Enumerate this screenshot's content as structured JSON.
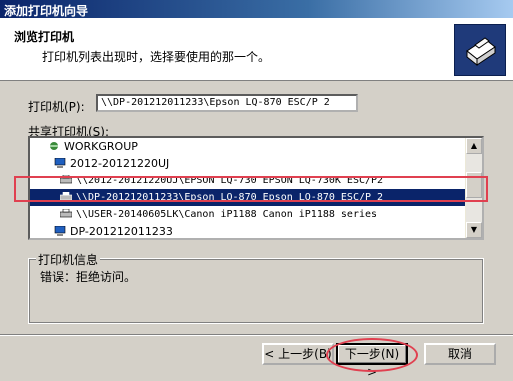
{
  "window": {
    "title": "添加打印机向导"
  },
  "header": {
    "title": "浏览打印机",
    "subtitle": "打印机列表出现时，选择要使用的那一个。",
    "logo_icon": "printer-wizard-icon"
  },
  "form": {
    "printer_label": "打印机(P):",
    "printer_value": "\\\\DP-201212011233\\Epson LQ-870 ESC/P 2",
    "shared_label": "共享打印机(S):"
  },
  "list": {
    "items": [
      {
        "label": "WORKGROUP",
        "icon": "network-workgroup-icon"
      },
      {
        "label": "2012-20121220UJ",
        "icon": "computer-icon"
      },
      {
        "label": "\\\\2012-20121220UJ\\EPSON LQ-730 EPSON LQ-730K ESC/P2",
        "icon": "printer-icon"
      },
      {
        "label": "\\\\DP-201212011233\\Epson LQ-870 Epson LQ-870 ESC/P 2",
        "icon": "printer-icon"
      },
      {
        "label": "\\\\USER-20140605LK\\Canon iP1188 Canon iP1188 series",
        "icon": "printer-icon"
      },
      {
        "label": "DP-201212011233",
        "icon": "computer-icon"
      }
    ]
  },
  "info": {
    "legend": "打印机信息",
    "text": "错误：拒绝访问。"
  },
  "buttons": {
    "back": "< 上一步(B)",
    "next": "下一步(N) >",
    "cancel": "取消"
  },
  "colors": {
    "selection": "#0a246a",
    "annotation": "#e04050"
  }
}
